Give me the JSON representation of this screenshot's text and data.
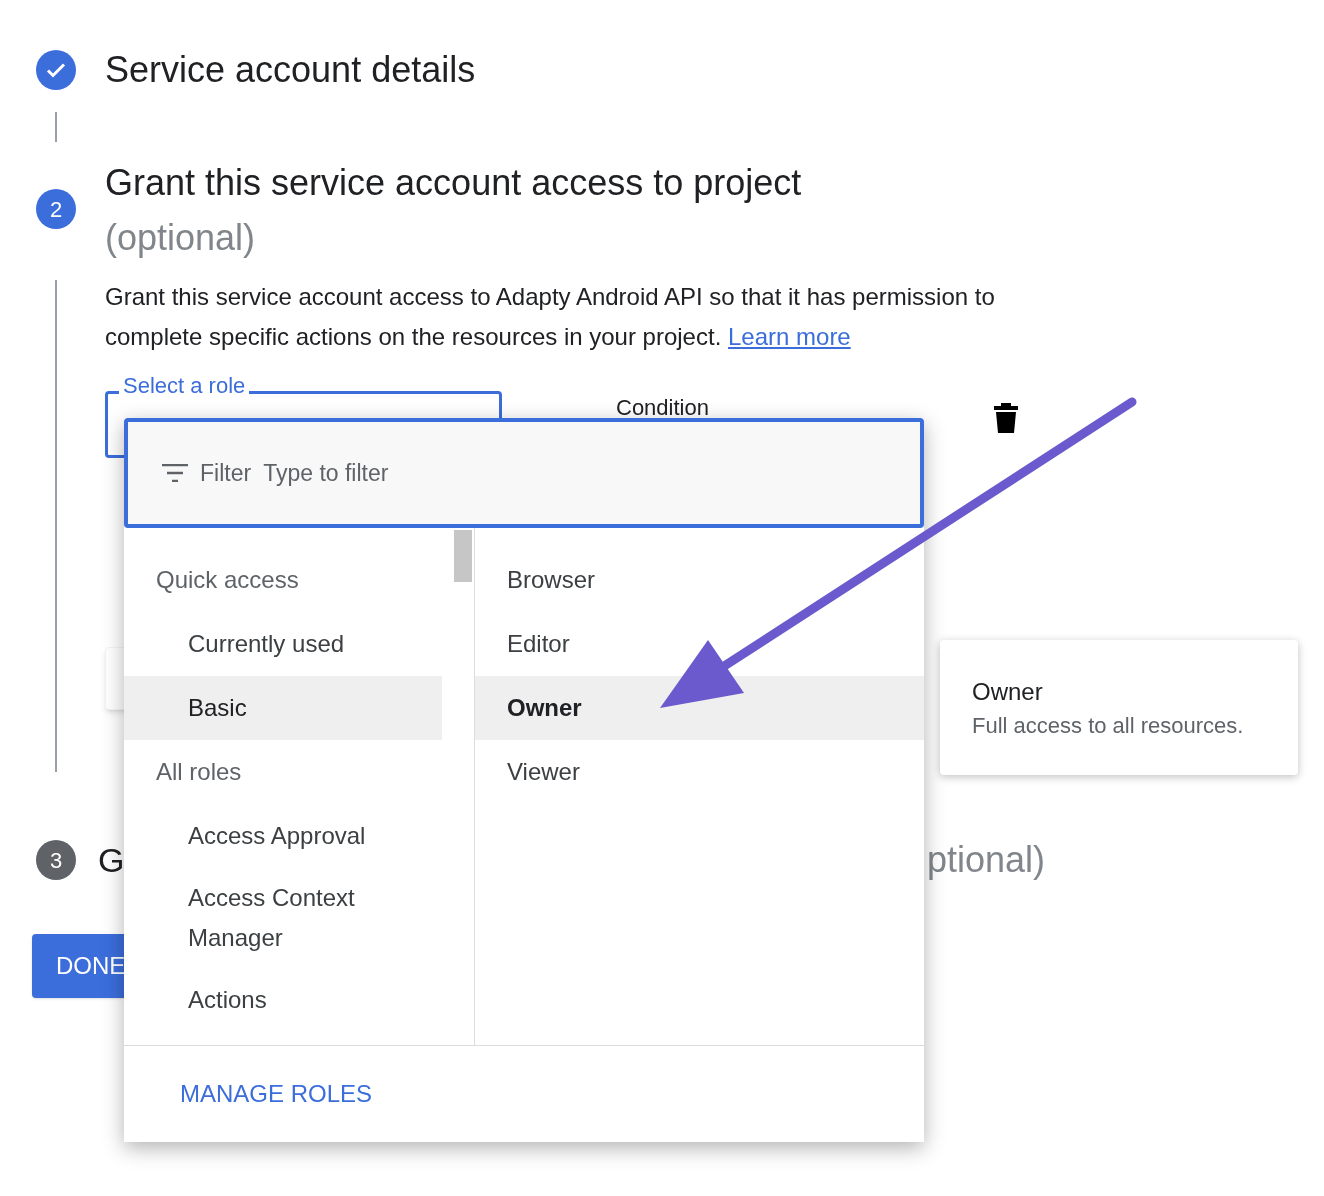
{
  "steps": [
    {
      "kind": "done",
      "title": "Service account details"
    },
    {
      "kind": "active",
      "number": "2",
      "title": "Grant this service account access to project",
      "title_note": "(optional)",
      "description": "Grant this service account access to Adapty Android API so that it has permission to complete specific actions on the resources in your project.",
      "link": "Learn more",
      "role_field": {
        "label": "Select a role"
      },
      "condition_label": "Condition"
    },
    {
      "kind": "pending",
      "number": "3",
      "title_start": "G",
      "title_end": "ptional)"
    }
  ],
  "done_button": "DONE",
  "role_menu": {
    "filter_label": "Filter",
    "filter_placeholder": "Type to filter",
    "categories": [
      {
        "kind": "header",
        "label": "Quick access"
      },
      {
        "kind": "item",
        "label": "Currently used",
        "selected": false
      },
      {
        "kind": "item",
        "label": "Basic",
        "selected": true
      },
      {
        "kind": "header",
        "label": "All roles"
      },
      {
        "kind": "item",
        "label": "Access Approval",
        "selected": false
      },
      {
        "kind": "item",
        "label": "Access Context Manager",
        "selected": false
      },
      {
        "kind": "item",
        "label": "Actions",
        "selected": false
      }
    ],
    "roles": [
      {
        "label": "Browser",
        "selected": false
      },
      {
        "label": "Editor",
        "selected": false
      },
      {
        "label": "Owner",
        "selected": true
      },
      {
        "label": "Viewer",
        "selected": false
      }
    ],
    "manage_button": "MANAGE ROLES"
  },
  "role_tooltip": {
    "title": "Owner",
    "description": "Full access to all resources."
  }
}
